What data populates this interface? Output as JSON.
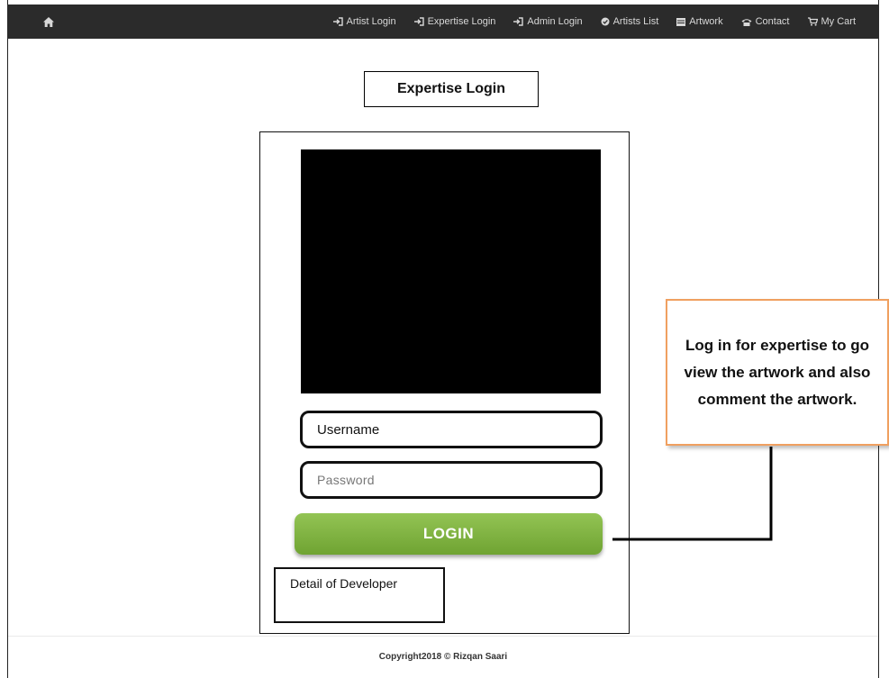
{
  "navbar": {
    "items": [
      {
        "label": "Artist Login",
        "icon": "login-icon"
      },
      {
        "label": "Expertise Login",
        "icon": "login-icon"
      },
      {
        "label": "Admin Login",
        "icon": "login-icon"
      },
      {
        "label": "Artists List",
        "icon": "artists-icon"
      },
      {
        "label": "Artwork",
        "icon": "artwork-icon"
      },
      {
        "label": "Contact",
        "icon": "phone-icon"
      },
      {
        "label": "My Cart",
        "icon": "cart-icon"
      }
    ]
  },
  "page": {
    "title": "Expertise Login"
  },
  "form": {
    "username_placeholder": "Username",
    "password_placeholder": "Password",
    "login_label": "LOGIN"
  },
  "developer": {
    "label": "Detail of Developer"
  },
  "footer": {
    "copyright": "Copyright2018 © Rizqan Saari"
  },
  "annotation": {
    "text": "Log in for expertise to go view the artwork and also comment the artwork."
  },
  "colors": {
    "navbar_bg": "#2b2b2b",
    "button_green": "#7fb342",
    "callout_border": "#f0a060"
  }
}
